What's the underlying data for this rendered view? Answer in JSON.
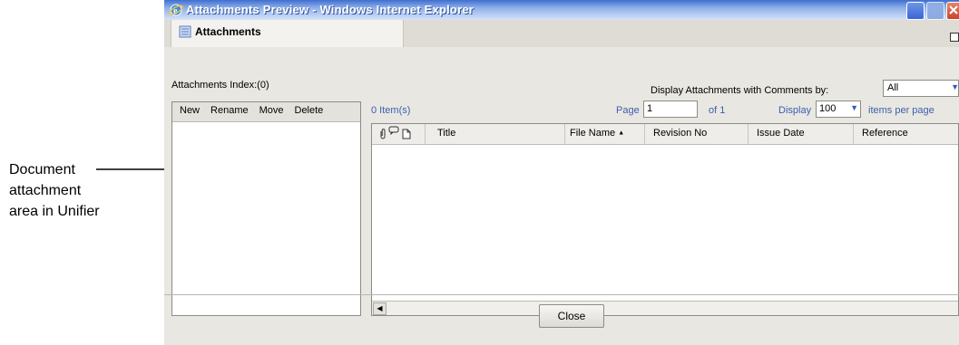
{
  "callout": {
    "lines": [
      "Document",
      "attachment",
      "area in Unifier"
    ]
  },
  "window": {
    "title": "Attachments Preview - Windows Internet Explorer",
    "tab_label": "Attachments",
    "colors": {
      "titlebar": "#3f6fd0",
      "panel_bg": "#e9e7e1",
      "link_text": "#3b5fb0"
    }
  },
  "attachments": {
    "index_label": "Attachments Index:(0)",
    "filter_label": "Display Attachments with Comments by:",
    "filter_value": "All",
    "toolbar": {
      "new": "New",
      "rename": "Rename",
      "move": "Move",
      "delete": "Delete"
    },
    "items_count": "0 Item(s)",
    "page_label": "Page",
    "page_value": "1",
    "of_label": "of 1",
    "display_label": "Display",
    "display_value": "100",
    "items_per_page": "items per page",
    "columns": [
      "Title",
      "File Name",
      "Revision No",
      "Issue Date",
      "Reference"
    ],
    "sort_indicator": "▲"
  },
  "footer": {
    "close_label": "Close"
  }
}
